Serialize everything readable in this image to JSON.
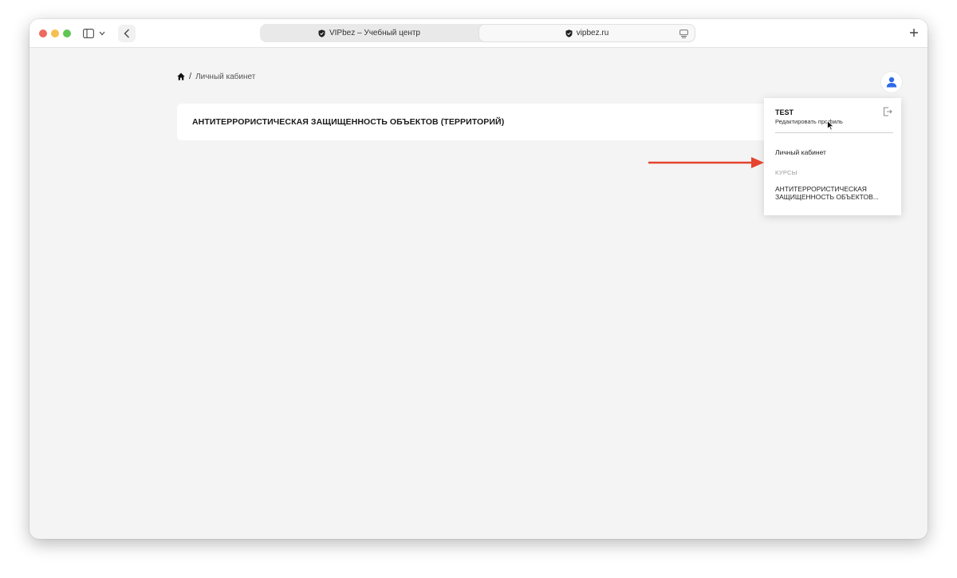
{
  "browser": {
    "tabs": [
      {
        "label": "VIPbez – Учебный центр"
      },
      {
        "label": "vipbez.ru"
      }
    ]
  },
  "breadcrumb": {
    "current": "Личный кабинет",
    "separator": "/"
  },
  "course_card": {
    "title": "АНТИТЕРРОРИСТИЧЕСКАЯ ЗАЩИЩЕННОСТЬ ОБЪЕКТОВ (ТЕРРИТОРИЙ)"
  },
  "user_menu": {
    "name": "TEST",
    "edit_profile": "Редактировать профиль",
    "cabinet_link": "Личный кабинет",
    "section_label": "КУРСЫ",
    "course_line1": "АНТИТЕРРОРИСТИЧЕСКАЯ",
    "course_line2": "ЗАЩИЩЕННОСТЬ ОБЪЕКТОВ..."
  },
  "colors": {
    "accent_blue": "#2f6ae8",
    "annotation_arrow": "#e5432f",
    "page_bg": "#f4f4f4"
  },
  "icons": [
    "home-icon",
    "user-icon",
    "logout-icon",
    "shield-icon",
    "sidebar-icon",
    "chevron-down-icon",
    "back-chevron-icon",
    "reader-icon",
    "plus-icon",
    "mouse-cursor-icon"
  ]
}
